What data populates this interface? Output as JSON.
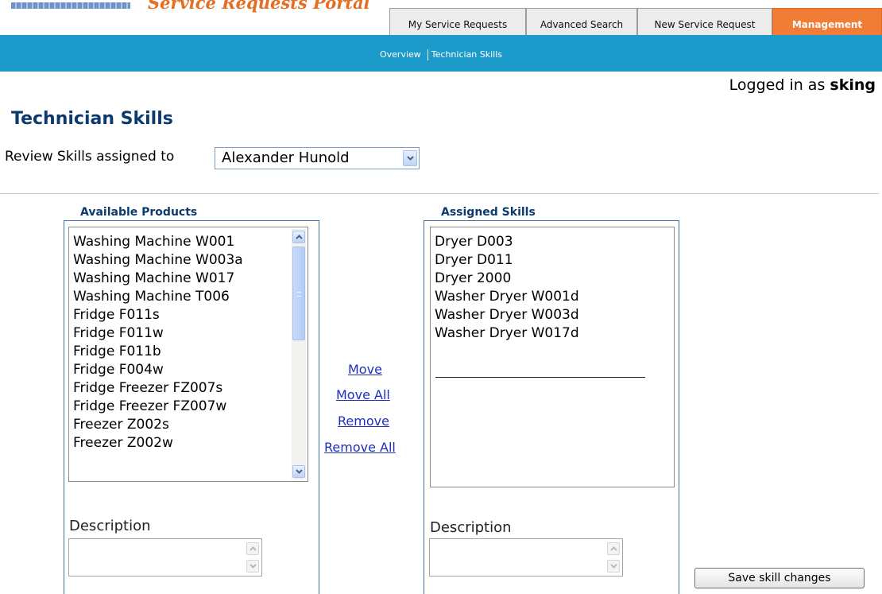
{
  "header": {
    "portal_title": "Service Requests Portal",
    "tabs": [
      {
        "label": "My Service Requests",
        "active": false
      },
      {
        "label": "Advanced Search",
        "active": false
      },
      {
        "label": "New Service Request",
        "active": false
      },
      {
        "label": "Management",
        "active": true
      }
    ],
    "subnav": {
      "overview": "Overview",
      "technician_skills": "Technician Skills"
    },
    "login": {
      "prefix": "Logged in as",
      "user": "sking"
    }
  },
  "colors": {
    "brand_orange": "#f07c35",
    "nav_blue": "#1c9bcb",
    "title_navy": "#0c3a6e",
    "link_blue": "#1f2fbd"
  },
  "page": {
    "title": "Technician Skills",
    "review_label": "Review Skills assigned to",
    "technician_selected": "Alexander Hunold"
  },
  "available": {
    "title": "Available Products",
    "items": [
      "Washing Machine W001",
      "Washing Machine W003a",
      "Washing Machine W017",
      "Washing Machine T006",
      "Fridge F011s",
      "Fridge F011w",
      "Fridge F011b",
      "Fridge F004w",
      "Fridge Freezer FZ007s",
      "Fridge Freezer FZ007w",
      "Freezer Z002s",
      "Freezer Z002w"
    ],
    "description_label": "Description"
  },
  "actions": {
    "move": "Move",
    "move_all": "Move All",
    "remove": "Remove",
    "remove_all": "Remove All"
  },
  "assigned": {
    "title": "Assigned Skills",
    "items": [
      "Dryer D003",
      "Dryer D011",
      "Dryer 2000",
      "Washer Dryer W001d",
      "Washer Dryer W003d",
      "Washer Dryer W017d"
    ],
    "description_label": "Description"
  },
  "save_label": "Save skill changes"
}
